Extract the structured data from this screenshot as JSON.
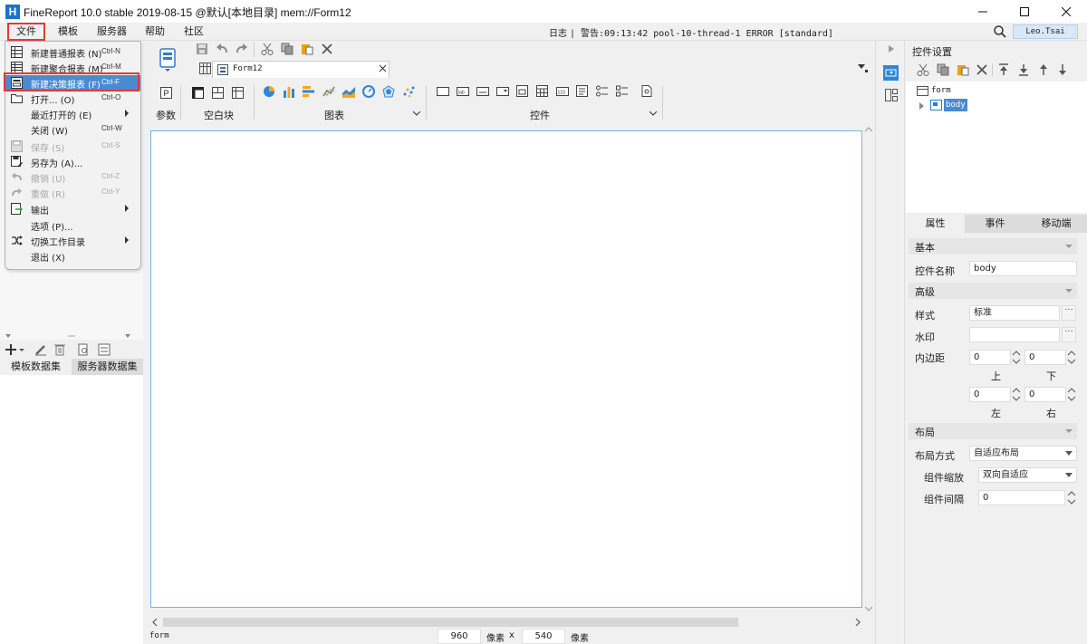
{
  "window": {
    "title": "FineReport 10.0 stable 2019-08-15 @默认[本地目录]    mem://Form12"
  },
  "menubar": {
    "items": [
      "文件",
      "模板",
      "服务器",
      "帮助",
      "社区"
    ],
    "log_label": "日志",
    "log_message": "| 警告:09:13:42 pool-10-thread-1 ERROR [standard]",
    "user": "Leo.Tsai"
  },
  "file_menu": {
    "items": [
      {
        "label": "新建普通报表 (N)",
        "shortcut": "Ctrl-N",
        "icon": "new-report-icon"
      },
      {
        "label": "新建聚合报表 (M)",
        "shortcut": "Ctrl-M",
        "icon": "new-aggregate-report-icon"
      },
      {
        "label": "新建决策报表 (F)",
        "shortcut": "Ctrl-F",
        "icon": "new-decision-report-icon"
      },
      {
        "label": "打开... (O)",
        "shortcut": "Ctrl-O",
        "icon": "open-folder-icon"
      },
      {
        "label": "最近打开的 (E)",
        "shortcut": "",
        "icon": ""
      },
      {
        "label": "关闭 (W)",
        "shortcut": "Ctrl-W",
        "icon": ""
      },
      {
        "label": "保存 (S)",
        "shortcut": "Ctrl-S",
        "icon": "save-icon"
      },
      {
        "label": "另存为 (A)...",
        "shortcut": "",
        "icon": "save-as-icon"
      },
      {
        "label": "撤销 (U)",
        "shortcut": "Ctrl-Z",
        "icon": "undo-icon"
      },
      {
        "label": "重做 (R)",
        "shortcut": "Ctrl-Y",
        "icon": "redo-icon"
      },
      {
        "label": "输出",
        "shortcut": "",
        "icon": "export-icon"
      },
      {
        "label": "选项 (P)...",
        "shortcut": "",
        "icon": ""
      },
      {
        "label": "切换工作目录",
        "shortcut": "",
        "icon": "switch-dir-icon"
      },
      {
        "label": "退出 (X)",
        "shortcut": "",
        "icon": ""
      }
    ]
  },
  "dataset_tabs": [
    "模板数据集",
    "服务器数据集"
  ],
  "doc_tab": {
    "label": "Form12"
  },
  "widget_bar": {
    "param_label": "参数",
    "blank_label": "空白块",
    "chart_label": "图表",
    "control_label": "控件"
  },
  "canvas": {
    "bottom_label": "form",
    "width_value": "960",
    "width_unit": "像素",
    "times": "x",
    "height_value": "540",
    "height_unit": "像素"
  },
  "right_panel": {
    "title": "控件设置",
    "tree": {
      "root": "form",
      "child": "body"
    },
    "tabs": [
      "属性",
      "事件",
      "移动端"
    ],
    "sections": {
      "basic": "基本",
      "advanced": "高级",
      "layout": "布局"
    },
    "props": {
      "name_label": "控件名称",
      "name_value": "body",
      "style_label": "样式",
      "style_value": "标准",
      "watermark_label": "水印",
      "watermark_value": "",
      "padding_label": "内边距",
      "pad_top": "0",
      "pad_bottom": "0",
      "pad_left": "0",
      "pad_right": "0",
      "top_label": "上",
      "bottom_label": "下",
      "left_label": "左",
      "right_label": "右",
      "layout_mode_label": "布局方式",
      "layout_mode_value": "自适应布局",
      "scale_label": "组件缩放",
      "scale_value": "双向自适应",
      "gap_label": "组件间隔",
      "gap_value": "0"
    }
  },
  "colors": {
    "highlight": "#4a8ad2",
    "annotation_red": "#e03a3a",
    "accent_blue": "#1a73c7",
    "user_bg": "#d9e8f8"
  }
}
